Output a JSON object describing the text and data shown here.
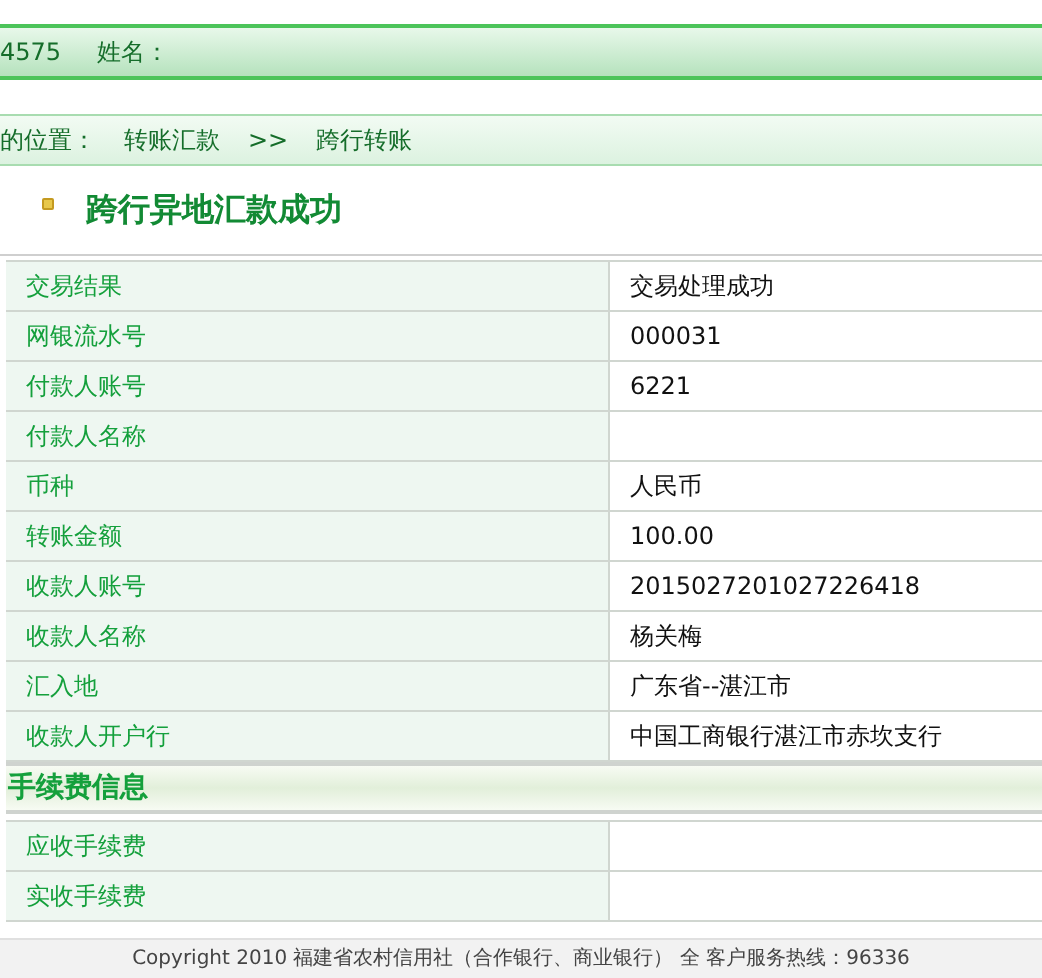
{
  "user_bar": {
    "account_tail": "4575",
    "name_label": "姓名："
  },
  "breadcrumb": {
    "label": "的位置：",
    "items": [
      "转账汇款",
      "跨行转账"
    ],
    "separator": ">>"
  },
  "title": "跨行异地汇款成功",
  "details": [
    {
      "label": "交易结果",
      "value": "交易处理成功"
    },
    {
      "label": "网银流水号",
      "value": "000031"
    },
    {
      "label": "付款人账号",
      "value": "6221"
    },
    {
      "label": "付款人名称"
    },
    {
      "label": "币种",
      "value": "人民币"
    },
    {
      "label": "转账金额",
      "value": "100.00"
    },
    {
      "label": "收款人账号",
      "value": "2015027201027226418"
    },
    {
      "label": "收款人名称",
      "value": "杨关梅"
    },
    {
      "label": "汇入地",
      "value": "广东省--湛江市"
    },
    {
      "label": "收款人开户行",
      "value": "中国工商银行湛江市赤坎支行"
    }
  ],
  "fee_section": {
    "title": "手续费信息",
    "rows": [
      {
        "label": "应收手续费"
      },
      {
        "label": "实收手续费"
      }
    ]
  },
  "footer": "Copyright 2010 福建省农村信用社（合作银行、商业银行） 全 客户服务热线：96336"
}
